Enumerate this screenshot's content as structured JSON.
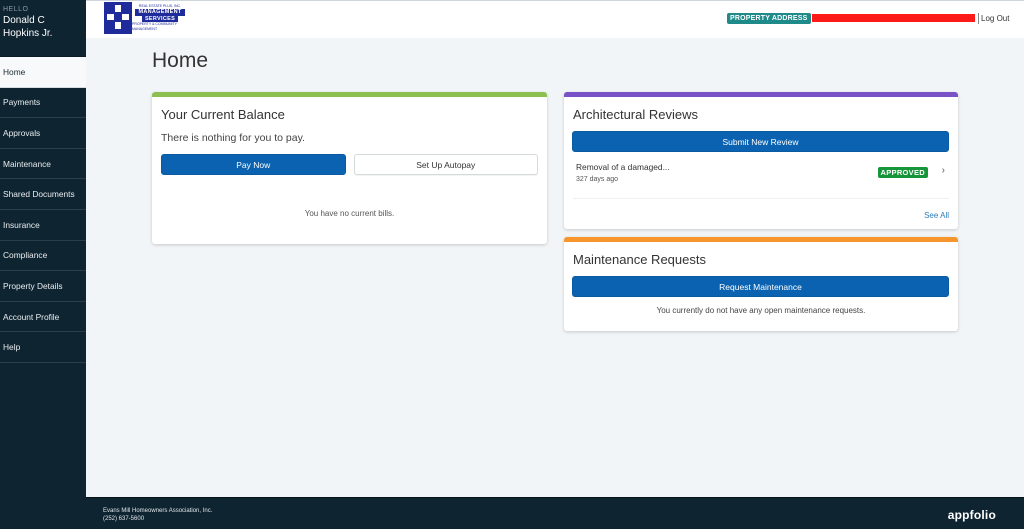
{
  "sidebar": {
    "greeting": "HELLO",
    "user_name_line1": "Donald C",
    "user_name_line2": "Hopkins Jr.",
    "items": [
      {
        "label": "Home",
        "active": true
      },
      {
        "label": "Payments"
      },
      {
        "label": "Approvals"
      },
      {
        "label": "Maintenance"
      },
      {
        "label": "Shared Documents"
      },
      {
        "label": "Insurance"
      },
      {
        "label": "Compliance"
      },
      {
        "label": "Property Details"
      },
      {
        "label": "Account Profile"
      },
      {
        "label": "Help"
      }
    ]
  },
  "header": {
    "logo": {
      "top_text": "REAL ESTATE PLUS, INC.",
      "main_text_1": "MANAGEMENT",
      "main_text_2": "SERVICES",
      "bottom_text": "PROPERTY & COMMUNITY MANAGEMENT"
    },
    "property_badge": "PROPERTY ADDRESS",
    "logout_label": "Log Out"
  },
  "main": {
    "page_title": "Home",
    "balance_card": {
      "title": "Your Current Balance",
      "accent_color": "#8cc152",
      "message": "There is nothing for you to pay.",
      "pay_now_label": "Pay Now",
      "autopay_label": "Set Up Autopay",
      "no_bills_text": "You have no current bills."
    },
    "architectural_card": {
      "title": "Architectural Reviews",
      "accent_color": "#7a52c7",
      "submit_label": "Submit New Review",
      "reviews": [
        {
          "title": "Removal of a damaged...",
          "age": "327 days ago",
          "status": "APPROVED"
        }
      ],
      "see_all_label": "See All"
    },
    "maintenance_card": {
      "title": "Maintenance Requests",
      "accent_color": "#f7962d",
      "request_label": "Request Maintenance",
      "empty_text": "You currently do not have any open maintenance requests."
    }
  },
  "footer": {
    "org_name": "Evans Mill Homeowners Association, Inc.",
    "phone": "(252) 637-5600",
    "brand": "appfolio"
  },
  "colors": {
    "sidebar_bg": "#0f2431",
    "primary_button": "#0a62b0",
    "approved_badge": "#17953a",
    "property_badge": "#1f8a8a"
  }
}
